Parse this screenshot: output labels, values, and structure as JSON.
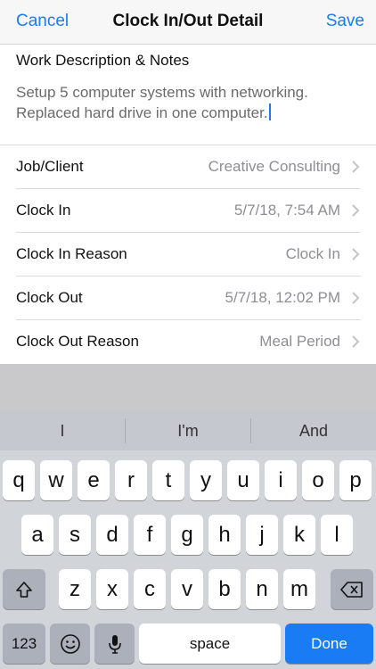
{
  "navbar": {
    "cancel_label": "Cancel",
    "title": "Clock In/Out Detail",
    "save_label": "Save"
  },
  "notes": {
    "title": "Work Description & Notes",
    "line1": "Setup 5 computer systems with networking.",
    "line2": "Replaced hard drive in one computer."
  },
  "rows": [
    {
      "label": "Job/Client",
      "value": "Creative Consulting"
    },
    {
      "label": "Clock In",
      "value": "5/7/18, 7:54 AM"
    },
    {
      "label": "Clock In Reason",
      "value": "Clock In"
    },
    {
      "label": "Clock Out",
      "value": "5/7/18, 12:02 PM"
    },
    {
      "label": "Clock Out Reason",
      "value": "Meal Period"
    }
  ],
  "keyboard": {
    "predictions": [
      "I",
      "I'm",
      "And"
    ],
    "row1": [
      "q",
      "w",
      "e",
      "r",
      "t",
      "y",
      "u",
      "i",
      "o",
      "p"
    ],
    "row2": [
      "a",
      "s",
      "d",
      "f",
      "g",
      "h",
      "j",
      "k",
      "l"
    ],
    "row3": [
      "z",
      "x",
      "c",
      "v",
      "b",
      "n",
      "m"
    ],
    "numbers_label": "123",
    "space_label": "space",
    "done_label": "Done"
  },
  "colors": {
    "accent": "#1a7cf5",
    "value_gray": "#8e8e93",
    "keyboard_bg": "#d1d4d9"
  },
  "icons": [
    "chevron-right-icon",
    "shift-icon",
    "delete-icon",
    "emoji-icon",
    "microphone-icon"
  ]
}
